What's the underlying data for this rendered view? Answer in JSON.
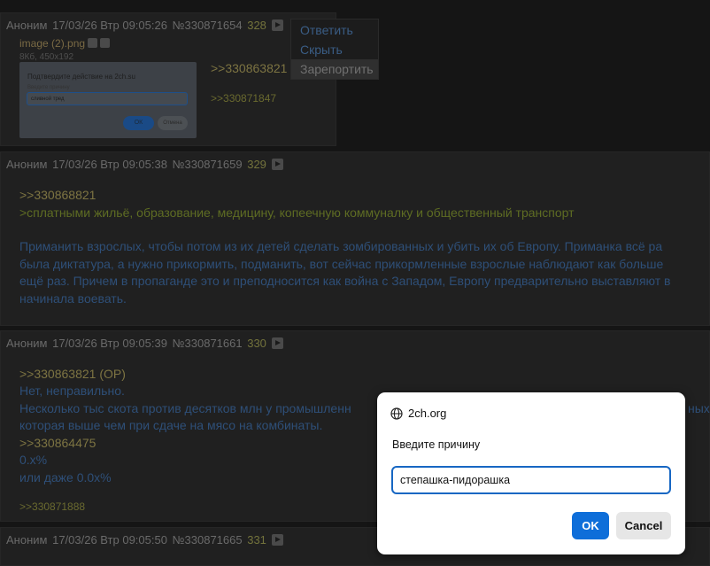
{
  "post1": {
    "author": "Аноним",
    "datetime": "17/03/26 Втр 09:05:26",
    "number": "№330871654",
    "count": "328",
    "file_name": "image (2).png",
    "file_meta": "8Кб, 450x192",
    "quote": ">>330863821",
    "reply": ">>330871847",
    "thumb": {
      "title": "Подтвердите действие на 2ch.su",
      "label": "Введите причину",
      "input": "сливной тред",
      "ok": "ОК",
      "cancel": "Отмена"
    }
  },
  "menu": {
    "items": [
      "Ответить",
      "Скрыть",
      "Зарепортить"
    ]
  },
  "post2": {
    "author": "Аноним",
    "datetime": "17/03/26 Втр 09:05:38",
    "number": "№330871659",
    "count": "329",
    "quote": ">>330868821",
    "greentext": ">сплатными жильё, образование, медицину, копеечную коммуналку и общественный транспорт",
    "lines": [
      "Приманить взрослых, чтобы потом из их детей сделать зомбированных и убить их об Европу. Приманка всё ра",
      "была диктатура, а нужно прикормить, подманить, вот сейчас прикормленные взрослые наблюдают как больше",
      "ещё раз. Причем в пропаганде это и преподносится как война с Западом, Европу предварительно выставляют в",
      "начинала воевать."
    ]
  },
  "post3": {
    "author": "Аноним",
    "datetime": "17/03/26 Втр 09:05:39",
    "number": "№330871661",
    "count": "330",
    "quote1": ">>330863821 (OP)",
    "line1": "Нет, неправильно.",
    "line2": "Несколько тыс скота против десятков млн у промышленн",
    "line2_tail": "ных",
    "line3": "которая выше чем при сдаче на мясо на комбинаты.",
    "quote2": ">>330864475",
    "line4": "0.x%",
    "line5": "или даже 0.0x%",
    "reply": ">>330871888"
  },
  "post4": {
    "author": "Аноним",
    "datetime": "17/03/26 Втр 09:05:50",
    "number": "№330871665",
    "count": "331"
  },
  "dialog": {
    "origin": "2ch.org",
    "label": "Введите причину",
    "value": "степашка-пидорашка",
    "ok": "OK",
    "cancel": "Cancel"
  }
}
